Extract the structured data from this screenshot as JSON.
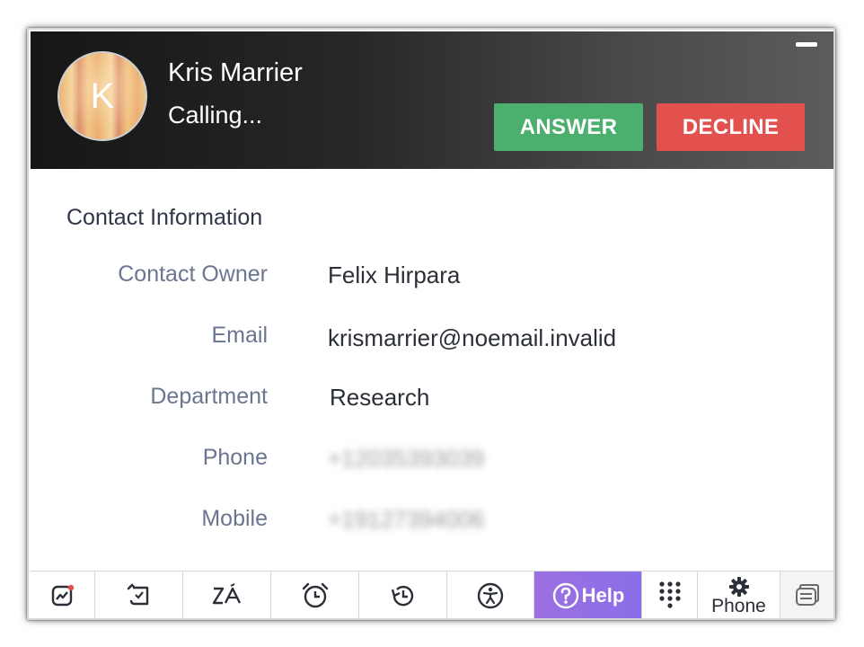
{
  "call": {
    "avatar_letter": "K",
    "caller_name": "Kris Marrier",
    "status": "Calling...",
    "answer_label": "ANSWER",
    "decline_label": "DECLINE"
  },
  "contact": {
    "section_title": "Contact Information",
    "fields": [
      {
        "label": "Contact Owner",
        "value": "Felix Hirpara"
      },
      {
        "label": "Email",
        "value": "krismarrier@noemail.invalid"
      },
      {
        "label": "Department",
        "value": "Research"
      },
      {
        "label": "Phone",
        "value": "+12035393039"
      },
      {
        "label": "Mobile",
        "value": "+19127394006"
      }
    ]
  },
  "toolbar": {
    "items": [
      {
        "icon": "chart-activity-icon"
      },
      {
        "icon": "tasks-icon"
      },
      {
        "icon": "translate-icon"
      },
      {
        "icon": "alarm-clock-icon"
      },
      {
        "icon": "history-icon"
      },
      {
        "icon": "accessibility-icon"
      },
      {
        "icon": "help-circle-icon"
      },
      {
        "icon": "dialpad-icon"
      },
      {
        "icon": "gear-icon"
      },
      {
        "icon": "notes-icon"
      }
    ],
    "help_label": "Help",
    "phone_label": "Phone"
  },
  "colors": {
    "answer": "#4caf6e",
    "decline": "#e2514e",
    "help": "#9c6fe0",
    "header_dark": "#161616",
    "label_text": "#6a7590"
  }
}
